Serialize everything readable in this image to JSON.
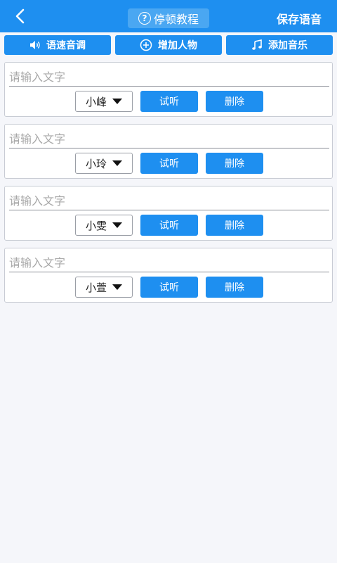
{
  "header": {
    "help_label": "停顿教程",
    "help_icon": "?",
    "save_label": "保存语音"
  },
  "toolbar": {
    "speed_label": "语速音调",
    "add_person_label": "增加人物",
    "add_music_label": "添加音乐"
  },
  "segments": [
    {
      "placeholder": "请输入文字",
      "voice": "小峰",
      "listen_label": "试听",
      "delete_label": "删除"
    },
    {
      "placeholder": "请输入文字",
      "voice": "小玲",
      "listen_label": "试听",
      "delete_label": "删除"
    },
    {
      "placeholder": "请输入文字",
      "voice": "小雯",
      "listen_label": "试听",
      "delete_label": "删除"
    },
    {
      "placeholder": "请输入文字",
      "voice": "小萱",
      "listen_label": "试听",
      "delete_label": "删除"
    }
  ],
  "colors": {
    "primary": "#1e8ff0",
    "background": "#f5f6fa"
  }
}
